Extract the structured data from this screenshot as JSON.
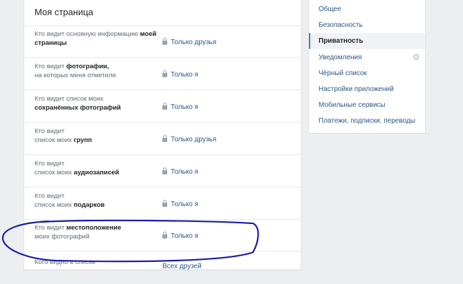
{
  "page": {
    "title": "Моя страница"
  },
  "settings": [
    {
      "label_pre": "Кто видит основную информацию",
      "label_bold": "моей страницы",
      "label_post": "",
      "value": "Только друзья"
    },
    {
      "label_pre": "Кто видит",
      "label_bold": "фотографии,",
      "label_post": "на которых меня отметили",
      "value": "Только я"
    },
    {
      "label_pre": "Кто видит список моих",
      "label_bold": "сохранённых фотографий",
      "label_post": "",
      "value": "Только я"
    },
    {
      "label_pre": "Кто видит список моих",
      "label_bold": "групп",
      "label_post": "",
      "value": "Только друзья"
    },
    {
      "label_pre": "Кто видит список моих",
      "label_bold": "аудиозаписей",
      "label_post": "",
      "value": "Только я"
    },
    {
      "label_pre": "Кто видит список моих",
      "label_bold": "подарков",
      "label_post": "",
      "value": "Только я"
    },
    {
      "label_pre": "Кто видит",
      "label_bold": "местоположение",
      "label_post": "моих фотографий",
      "value": "Только я"
    },
    {
      "label_pre": "Кого видно в списке",
      "label_bold": "",
      "label_post": "",
      "value": "Всех друзей"
    }
  ],
  "menu": [
    {
      "label": "Общее"
    },
    {
      "label": "Безопасность"
    },
    {
      "label": "Приватность",
      "active": true
    },
    {
      "label": "Уведомления"
    },
    {
      "label": "Чёрный список"
    },
    {
      "label": "Настройки приложений"
    },
    {
      "label": "Мобильные сервисы"
    },
    {
      "label": "Платежи, подписки, переводы"
    }
  ],
  "colors": {
    "link": "#2a5885",
    "highlight_stroke": "#1a1aa6"
  },
  "icons": {
    "lock": "lock-icon",
    "gear": "gear-icon"
  }
}
